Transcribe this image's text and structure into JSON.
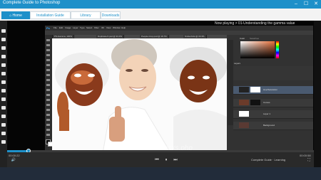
{
  "window": {
    "title": "Complete Guide to Photoshop",
    "controls": [
      "–",
      "☐",
      "✕"
    ]
  },
  "nav": {
    "tabs": [
      {
        "label": "Home",
        "icon": "home-icon",
        "active": true
      },
      {
        "label": "Installation Guide",
        "active": false
      },
      {
        "label": "Library",
        "active": false
      },
      {
        "label": "Downloads",
        "active": false
      }
    ]
  },
  "player": {
    "now_playing": "Now playing > 01-Understanding the gamma value",
    "time_current": "00:00:22",
    "time_total": "00:00:58",
    "progress": 0.07
  },
  "photoshop": {
    "menu": [
      "Ps",
      "File",
      "Edit",
      "Image",
      "Layer",
      "Type",
      "Select",
      "Filter",
      "3D",
      "View",
      "Window",
      "Help"
    ],
    "doc_tabs": [
      "PS-Gamma, 100%",
      "Duplicate-5.psd @ 33.3%",
      "People-Crop.psd @ 16.7%",
      "Smile-Kids @ 33.3%"
    ],
    "panel_tabs": [
      "Color",
      "Swatches"
    ],
    "layers_title": "Layers",
    "layers": [
      {
        "name": "Hue/Saturation",
        "selected": true
      },
      {
        "name": "Curves",
        "selected": false
      },
      {
        "name": "Layer 1",
        "selected": false
      },
      {
        "name": "Background",
        "selected": false
      }
    ]
  },
  "watermark": "dreamstime.com/lacks.php",
  "logo": "Complete Guide · Learning"
}
